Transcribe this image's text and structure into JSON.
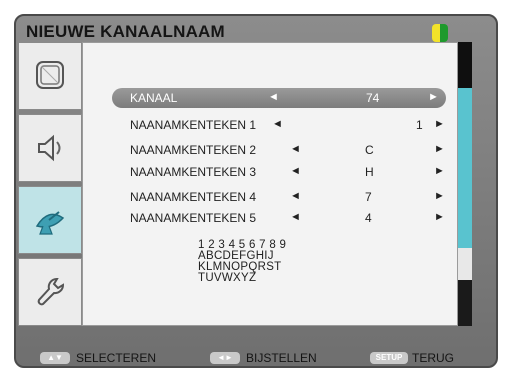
{
  "menu": {
    "title": "NIEUWE KANAALNAAM",
    "badge_colors": {
      "left": "#f2e32a",
      "right": "#1e9a2c"
    }
  },
  "sidebar": {
    "items": [
      {
        "icon": "screen-icon"
      },
      {
        "icon": "speaker-icon"
      },
      {
        "icon": "satellite-dish-icon"
      },
      {
        "icon": "wrench-icon"
      }
    ],
    "active_index": 2,
    "accent": "#bfe3e7"
  },
  "rows": [
    {
      "label": "KANAAL",
      "left_arrow": "◄",
      "value": "74",
      "right_arrow": "►"
    },
    {
      "label": "NAANAMKENTEKEN  1",
      "left_arrow": "◄",
      "value": "1",
      "right_arrow": "►"
    },
    {
      "label": "NAANAMKENTEKEN  2",
      "left_arrow": "◄",
      "value": "C",
      "right_arrow": "►"
    },
    {
      "label": "NAANAMKENTEKEN 3",
      "left_arrow": "◄",
      "value": "H",
      "right_arrow": "►"
    },
    {
      "label": "NAANAMKENTEKEN 4",
      "left_arrow": "◄",
      "value": "7",
      "right_arrow": "►"
    },
    {
      "label": "NAANAMKENTEKEN 5",
      "left_arrow": "◄",
      "value": "4",
      "right_arrow": "►"
    }
  ],
  "charset": {
    "line1": "1 2 3 4 5 6 7 8 9",
    "line2": "ABCDEFGHIJ",
    "line3": "KLMNOPQRST",
    "line4": "TUVWXYZ"
  },
  "footer": {
    "select_key": "▲▼",
    "select_label": "SELECTEREN",
    "adjust_key": "◄►",
    "adjust_label": "BIJSTELLEN",
    "back_key": "SETUP",
    "back_label": "TERUG"
  }
}
